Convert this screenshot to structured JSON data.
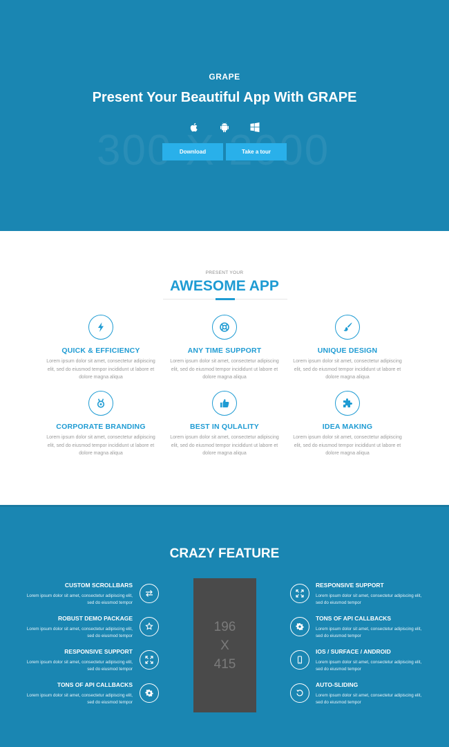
{
  "hero": {
    "brand": "GRAPE",
    "title": "Present Your Beautiful App With GRAPE",
    "placeholder_text": "300 X 2000",
    "platforms": [
      "apple-icon",
      "android-icon",
      "windows-icon"
    ],
    "buttons": {
      "download": "Download",
      "tour": "Take a tour"
    },
    "background": "#1a86b2",
    "button_color": "#29b0ea"
  },
  "awesome": {
    "kicker": "PRESENT YOUR",
    "title": "AWESOME APP",
    "accent": "#1e9bd3",
    "features": [
      {
        "title": "QUICK & EFFICIENCY",
        "icon": "lightning-icon",
        "desc": "Lorem ipsum dolor sit amet, consectetur adipiscing elit, sed do eiusmod tempor incididunt ut labore et dolore magna aliqua"
      },
      {
        "title": "ANY TIME SUPPORT",
        "icon": "lifebuoy-icon",
        "desc": "Lorem ipsum dolor sit amet, consectetur adipiscing elit, sed do eiusmod tempor incididunt ut labore et dolore magna aliqua"
      },
      {
        "title": "UNIQUE DESIGN",
        "icon": "paintbrush-icon",
        "desc": "Lorem ipsum dolor sit amet, consectetur adipiscing elit, sed do eiusmod tempor incididunt ut labore et dolore magna aliqua"
      },
      {
        "title": "CORPORATE BRANDING",
        "icon": "badge-icon",
        "desc": "Lorem ipsum dolor sit amet, consectetur adipiscing elit, sed do eiusmod tempor incididunt ut labore et dolore magna aliqua"
      },
      {
        "title": "BEST IN QULALITY",
        "icon": "thumbs-up-icon",
        "desc": "Lorem ipsum dolor sit amet, consectetur adipiscing elit, sed do eiusmod tempor incididunt ut labore et dolore magna aliqua"
      },
      {
        "title": "IDEA MAKING",
        "icon": "puzzle-icon",
        "desc": "Lorem ipsum dolor sit amet, consectetur adipiscing elit, sed do eiusmod tempor incididunt ut labore et dolore magna aliqua"
      }
    ]
  },
  "crazy": {
    "title": "CRAZY FEATURE",
    "phone_placeholder": {
      "w": "196",
      "x": "X",
      "h": "415"
    },
    "left": [
      {
        "title": "CUSTOM SCROLLBARS",
        "icon": "swap-arrows-icon",
        "desc": "Lorem ipsum dolor sit amet, consectetur adipiscing elit, sed do eiusmod tempor"
      },
      {
        "title": "ROBUST DEMO PACKAGE",
        "icon": "star-badge-icon",
        "desc": "Lorem ipsum dolor sit amet, consectetur adipiscing elit, sed do eiusmod tempor"
      },
      {
        "title": "RESPONSIVE SUPPORT",
        "icon": "expand-icon",
        "desc": "Lorem ipsum dolor sit amet, consectetur adipiscing elit, sed do eiusmod tempor"
      },
      {
        "title": "TONS OF API CALLBACKS",
        "icon": "cog-icon",
        "desc": "Lorem ipsum dolor sit amet, consectetur adipiscing elit, sed do eiusmod tempor"
      }
    ],
    "right": [
      {
        "title": "RESPONSIVE SUPPORT",
        "icon": "expand-icon",
        "desc": "Lorem ipsum dolor sit amet, consectetur adipiscing elit, sed do eiusmod tempor"
      },
      {
        "title": "TONS OF API CALLBACKS",
        "icon": "cog-icon",
        "desc": "Lorem ipsum dolor sit amet, consectetur adipiscing elit, sed do eiusmod tempor"
      },
      {
        "title": "IOS / SURFACE / ANDROID",
        "icon": "mobile-icon",
        "desc": "Lorem ipsum dolor sit amet, consectetur adipiscing elit, sed do eiusmod tempor"
      },
      {
        "title": "AUTO-SLIDING",
        "icon": "refresh-icon",
        "desc": "Lorem ipsum dolor sit amet, consectetur adipiscing elit, sed do eiusmod tempor"
      }
    ]
  }
}
